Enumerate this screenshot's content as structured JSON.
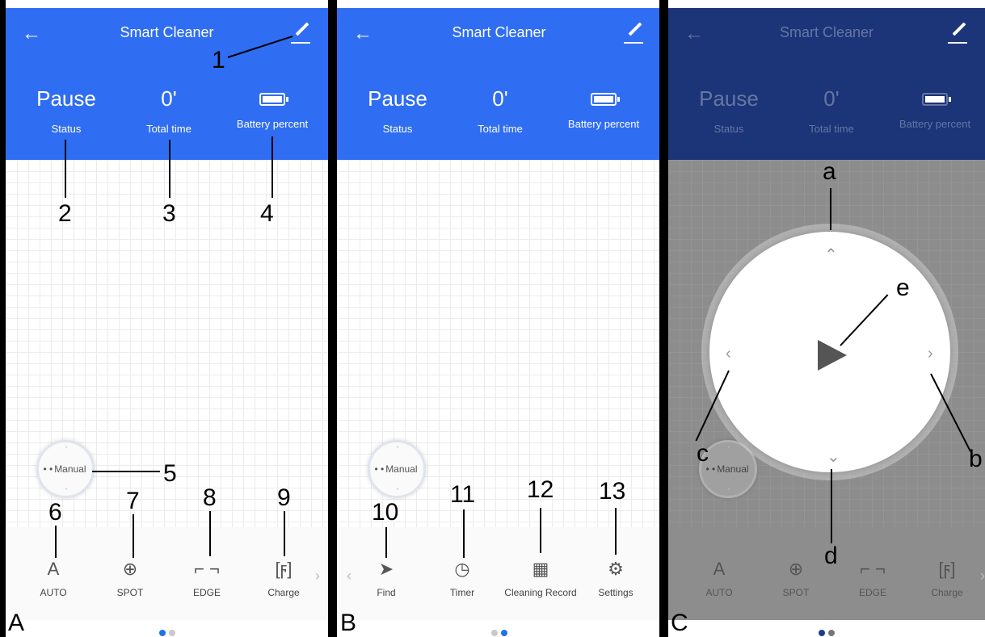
{
  "header": {
    "title": "Smart Cleaner",
    "stats": [
      {
        "value": "Pause",
        "label": "Status"
      },
      {
        "value": "0'",
        "label": "Total time"
      },
      {
        "value": "",
        "label": "Battery percent"
      }
    ]
  },
  "manual_label": "Manual",
  "page1_items": [
    {
      "label": "AUTO",
      "icon": "letter-a-icon"
    },
    {
      "label": "SPOT",
      "icon": "crosshair-icon"
    },
    {
      "label": "EDGE",
      "icon": "frame-corners-icon"
    },
    {
      "label": "Charge",
      "icon": "charge-icon"
    }
  ],
  "page2_items": [
    {
      "label": "Find",
      "icon": "navigation-arrow-icon"
    },
    {
      "label": "Timer",
      "icon": "clock-icon"
    },
    {
      "label": "Cleaning Record",
      "icon": "calendar-icon"
    },
    {
      "label": "Settings",
      "icon": "gear-icon"
    }
  ],
  "panel_labels": [
    "A",
    "B",
    "C"
  ],
  "annotations": {
    "numbers": [
      "1",
      "2",
      "3",
      "4",
      "5",
      "6",
      "7",
      "8",
      "9",
      "10",
      "11",
      "12",
      "13"
    ],
    "letters": [
      "a",
      "b",
      "c",
      "d",
      "e"
    ]
  },
  "colors": {
    "header_blue": "#2f6df2",
    "header_dimmed": "#1c3478",
    "page_dot_active": "#1e73e8"
  }
}
